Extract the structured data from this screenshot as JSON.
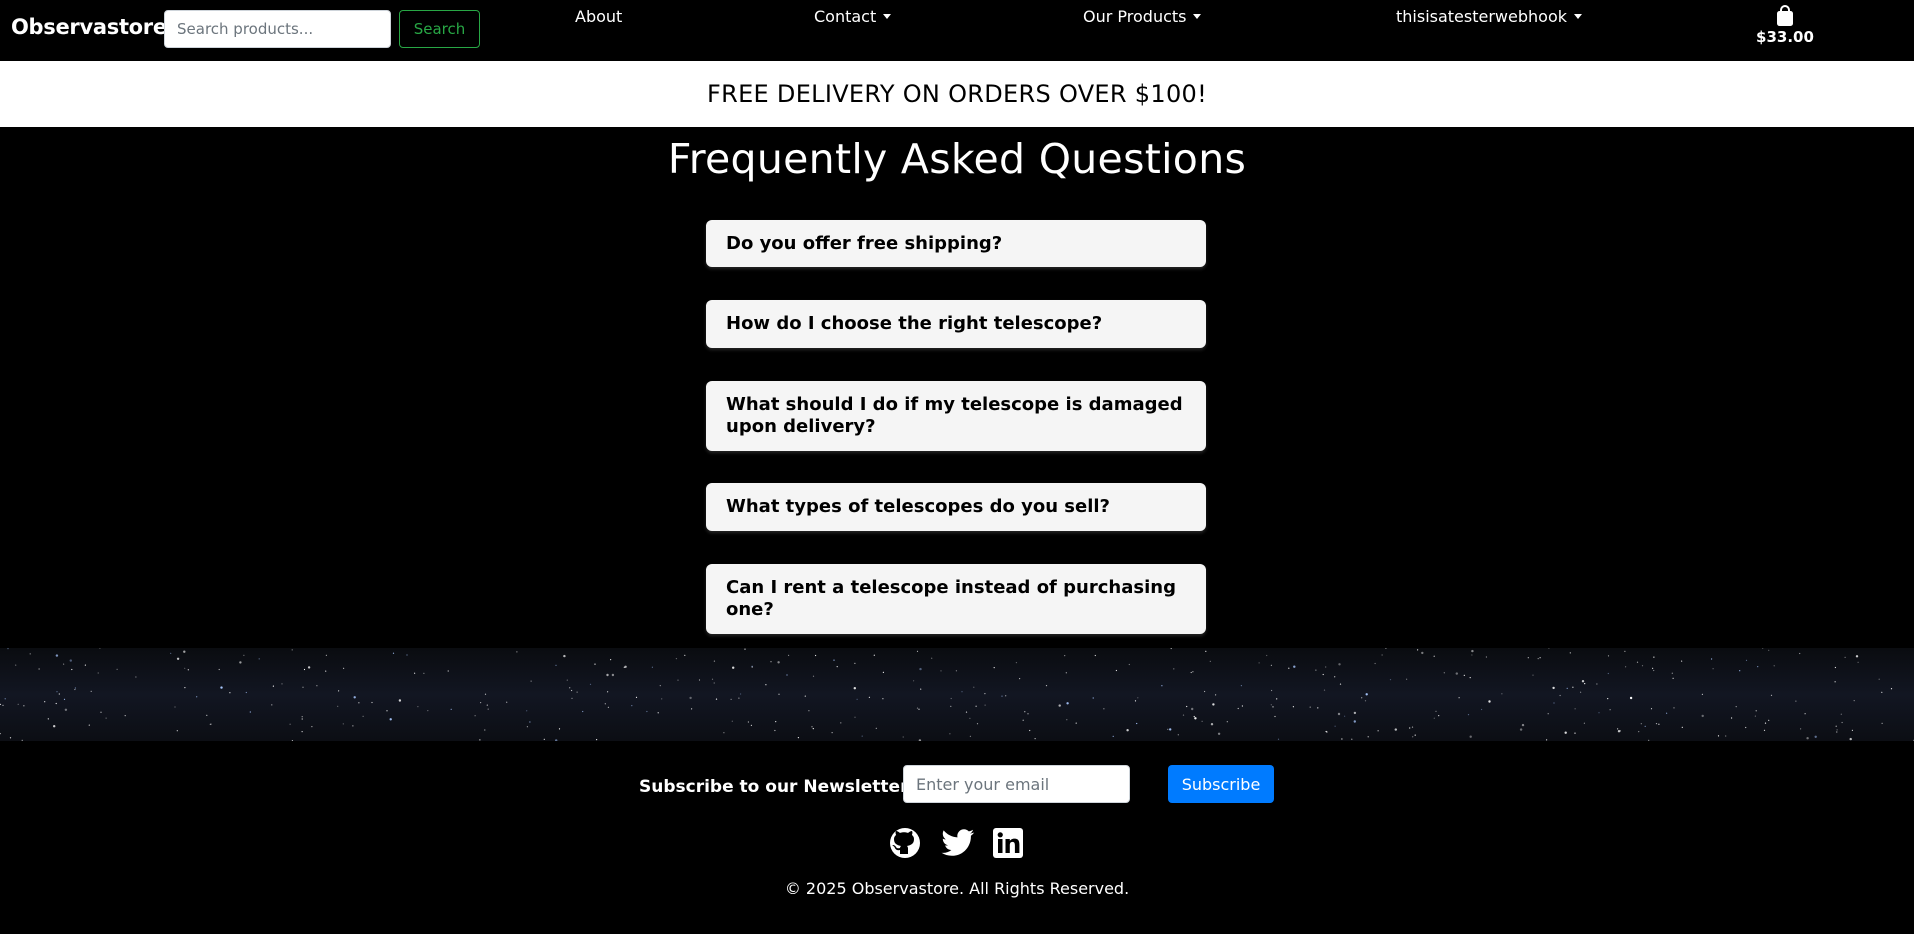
{
  "navbar": {
    "brand": "Observastore",
    "search_placeholder": "Search products...",
    "search_button": "Search",
    "links": [
      {
        "label": "About",
        "icon": ""
      },
      {
        "label": "Contact",
        "icon": "caret-down-icon"
      },
      {
        "label": "Our Products",
        "icon": "caret-down-icon"
      },
      {
        "label": "thisisatesterwebhook",
        "icon": "caret-down-icon"
      }
    ],
    "cart": {
      "icon": "shopping-bag-icon",
      "total": "$33.00"
    }
  },
  "banner": {
    "text": "FREE DELIVERY ON ORDERS OVER $100!"
  },
  "faq": {
    "title": "Frequently Asked Questions",
    "questions": [
      "Do you offer free shipping?",
      "How do I choose the right telescope?",
      "What should I do if my telescope is damaged upon delivery?",
      "What types of telescopes do you sell?",
      "Can I rent a telescope instead of purchasing one?"
    ]
  },
  "footer": {
    "newsletter_label": "Subscribe to our Newsletter",
    "email_placeholder": "Enter your email",
    "subscribe_button": "Subscribe",
    "social": [
      "github-icon",
      "twitter-icon",
      "linkedin-icon"
    ],
    "copyright": "© 2025 Observastore. All Rights Reserved."
  },
  "colors": {
    "background": "#000000",
    "search_button": "#28a745",
    "subscribe_button": "#007bff",
    "faq_card": "#f5f5f5",
    "banner": "#ffffff"
  }
}
